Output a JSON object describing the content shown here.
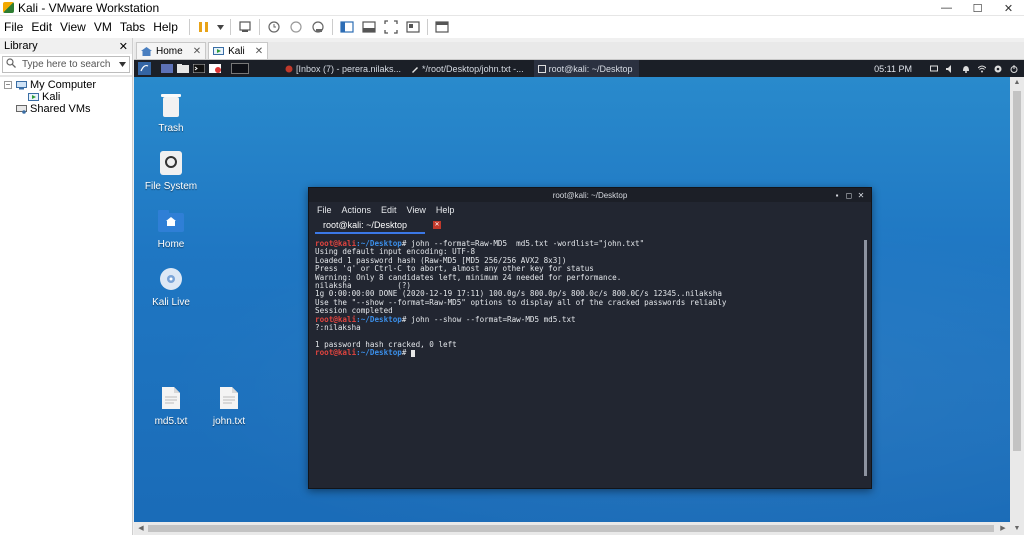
{
  "window": {
    "title": "Kali - VMware Workstation",
    "controls": [
      "—",
      "☐",
      "✕"
    ]
  },
  "menubar": {
    "items": [
      "File",
      "Edit",
      "View",
      "VM",
      "Tabs",
      "Help"
    ]
  },
  "library": {
    "header": "Library",
    "close": "✕",
    "search_placeholder": "Type here to search",
    "tree": {
      "root": "My Computer",
      "vm": "Kali",
      "shared": "Shared VMs"
    }
  },
  "tabs": [
    {
      "label": "Home",
      "close": "✕"
    },
    {
      "label": "Kali",
      "close": "✕"
    }
  ],
  "guest_panel": {
    "tasks": [
      "[Inbox (7) - perera.nilaks...",
      "*/root/Desktop/john.txt -...",
      "root@kali: ~/Desktop"
    ],
    "clock": "05:11 PM"
  },
  "desktop_icons": [
    "Trash",
    "File System",
    "Home",
    "Kali Live",
    "md5.txt",
    "john.txt"
  ],
  "terminal": {
    "title": "root@kali: ~/Desktop",
    "menu": [
      "File",
      "Actions",
      "Edit",
      "View",
      "Help"
    ],
    "tab_label": "root@kali: ~/Desktop",
    "prompt_user": "root@kali",
    "prompt_path": ":~/Desktop",
    "prompt_symbol": "#",
    "lines": [
      {
        "prompt": true,
        "cmd": " john --format=Raw-MD5  md5.txt -wordlist=\"john.txt\""
      },
      {
        "text": "Using default input encoding: UTF-8"
      },
      {
        "text": "Loaded 1 password hash (Raw-MD5 [MD5 256/256 AVX2 8x3])"
      },
      {
        "text": "Press 'q' or Ctrl-C to abort, almost any other key for status"
      },
      {
        "text": "Warning: Only 8 candidates left, minimum 24 needed for performance."
      },
      {
        "text": "nilaksha          (?)"
      },
      {
        "text": "1g 0:00:00:00 DONE (2020-12-19 17:11) 100.0g/s 800.0p/s 800.0c/s 800.0C/s 12345..nilaksha"
      },
      {
        "text": "Use the \"--show --format=Raw-MD5\" options to display all of the cracked passwords reliably"
      },
      {
        "text": "Session completed"
      },
      {
        "prompt": true,
        "cmd": " john --show --format=Raw-MD5 md5.txt"
      },
      {
        "text": "?:nilaksha"
      },
      {
        "text": ""
      },
      {
        "text": "1 password hash cracked, 0 left"
      },
      {
        "prompt": true,
        "cmd": " ",
        "cursor": true
      }
    ]
  }
}
